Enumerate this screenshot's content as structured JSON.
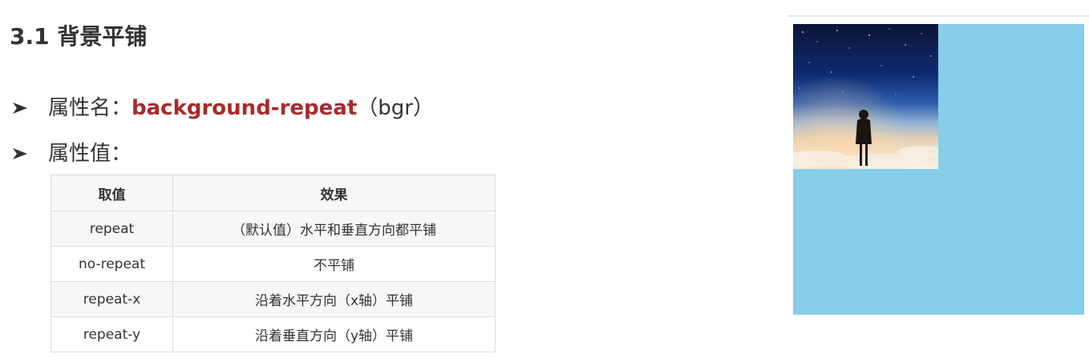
{
  "section": {
    "title": "3.1 背景平铺"
  },
  "bullets": {
    "name_label": "属性名：",
    "name_value": "background-repeat",
    "name_abbrev": "（bgr）",
    "value_label": "属性值："
  },
  "table": {
    "headers": [
      "取值",
      "效果"
    ],
    "rows": [
      [
        "repeat",
        "（默认值）水平和垂直方向都平铺"
      ],
      [
        "no-repeat",
        "不平铺"
      ],
      [
        "repeat-x",
        "沿着水平方向（x轴）平铺"
      ],
      [
        "repeat-y",
        "沿着垂直方向（y轴）平铺"
      ]
    ]
  },
  "preview": {
    "box_color": "#87ceeb",
    "image": "night-sky-girl-silhouette"
  },
  "colors": {
    "accent": "#a72a2a",
    "text": "#333333"
  }
}
